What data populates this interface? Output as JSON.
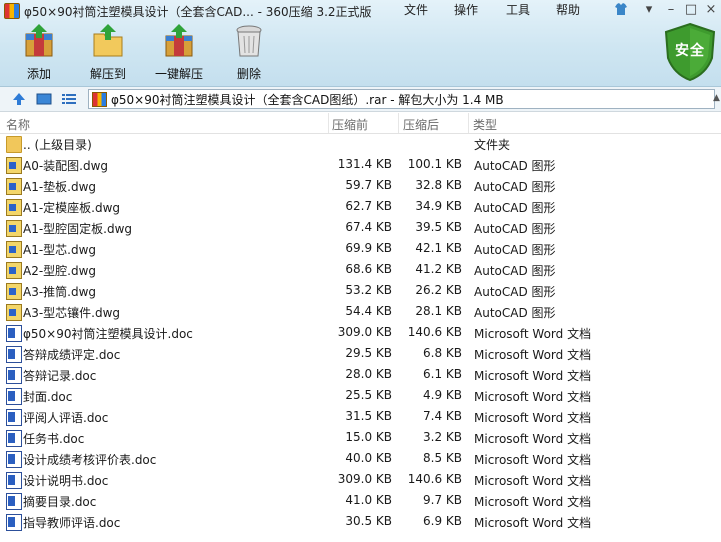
{
  "window": {
    "title": "φ50×90衬筒注塑模具设计（全套含CAD... - 360压缩 3.2正式版",
    "menus": [
      "文件",
      "操作",
      "工具",
      "帮助"
    ],
    "safety_label": "安全"
  },
  "toolbar": {
    "add": "添加",
    "extract_to": "解压到",
    "one_click_extract": "一键解压",
    "delete": "删除"
  },
  "address": {
    "path": "φ50×90衬筒注塑模具设计（全套含CAD图纸）.rar - 解包大小为 1.4 MB"
  },
  "columns": {
    "name": "名称",
    "size": "压缩前",
    "packed": "压缩后",
    "type": "类型"
  },
  "files": [
    {
      "name": ".. (上级目录)",
      "size": "",
      "packed": "",
      "type": "文件夹",
      "icon": "folder"
    },
    {
      "name": "A0-装配图.dwg",
      "size": "131.4 KB",
      "packed": "100.1 KB",
      "type": "AutoCAD 图形",
      "icon": "dwg"
    },
    {
      "name": "A1-垫板.dwg",
      "size": "59.7 KB",
      "packed": "32.8 KB",
      "type": "AutoCAD 图形",
      "icon": "dwg"
    },
    {
      "name": "A1-定模座板.dwg",
      "size": "62.7 KB",
      "packed": "34.9 KB",
      "type": "AutoCAD 图形",
      "icon": "dwg"
    },
    {
      "name": "A1-型腔固定板.dwg",
      "size": "67.4 KB",
      "packed": "39.5 KB",
      "type": "AutoCAD 图形",
      "icon": "dwg"
    },
    {
      "name": "A1-型芯.dwg",
      "size": "69.9 KB",
      "packed": "42.1 KB",
      "type": "AutoCAD 图形",
      "icon": "dwg"
    },
    {
      "name": "A2-型腔.dwg",
      "size": "68.6 KB",
      "packed": "41.2 KB",
      "type": "AutoCAD 图形",
      "icon": "dwg"
    },
    {
      "name": "A3-推筒.dwg",
      "size": "53.2 KB",
      "packed": "26.2 KB",
      "type": "AutoCAD 图形",
      "icon": "dwg"
    },
    {
      "name": "A3-型芯镶件.dwg",
      "size": "54.4 KB",
      "packed": "28.1 KB",
      "type": "AutoCAD 图形",
      "icon": "dwg"
    },
    {
      "name": "φ50×90衬筒注塑模具设计.doc",
      "size": "309.0 KB",
      "packed": "140.6 KB",
      "type": "Microsoft Word 文档",
      "icon": "doc"
    },
    {
      "name": "答辩成绩评定.doc",
      "size": "29.5 KB",
      "packed": "6.8 KB",
      "type": "Microsoft Word 文档",
      "icon": "doc"
    },
    {
      "name": "答辩记录.doc",
      "size": "28.0 KB",
      "packed": "6.1 KB",
      "type": "Microsoft Word 文档",
      "icon": "doc"
    },
    {
      "name": "封面.doc",
      "size": "25.5 KB",
      "packed": "4.9 KB",
      "type": "Microsoft Word 文档",
      "icon": "doc"
    },
    {
      "name": "评阅人评语.doc",
      "size": "31.5 KB",
      "packed": "7.4 KB",
      "type": "Microsoft Word 文档",
      "icon": "doc"
    },
    {
      "name": "任务书.doc",
      "size": "15.0 KB",
      "packed": "3.2 KB",
      "type": "Microsoft Word 文档",
      "icon": "doc"
    },
    {
      "name": "设计成绩考核评价表.doc",
      "size": "40.0 KB",
      "packed": "8.5 KB",
      "type": "Microsoft Word 文档",
      "icon": "doc"
    },
    {
      "name": "设计说明书.doc",
      "size": "309.0 KB",
      "packed": "140.6 KB",
      "type": "Microsoft Word 文档",
      "icon": "doc"
    },
    {
      "name": "摘要目录.doc",
      "size": "41.0 KB",
      "packed": "9.7 KB",
      "type": "Microsoft Word 文档",
      "icon": "doc"
    },
    {
      "name": "指导教师评语.doc",
      "size": "30.5 KB",
      "packed": "6.9 KB",
      "type": "Microsoft Word 文档",
      "icon": "doc"
    }
  ]
}
